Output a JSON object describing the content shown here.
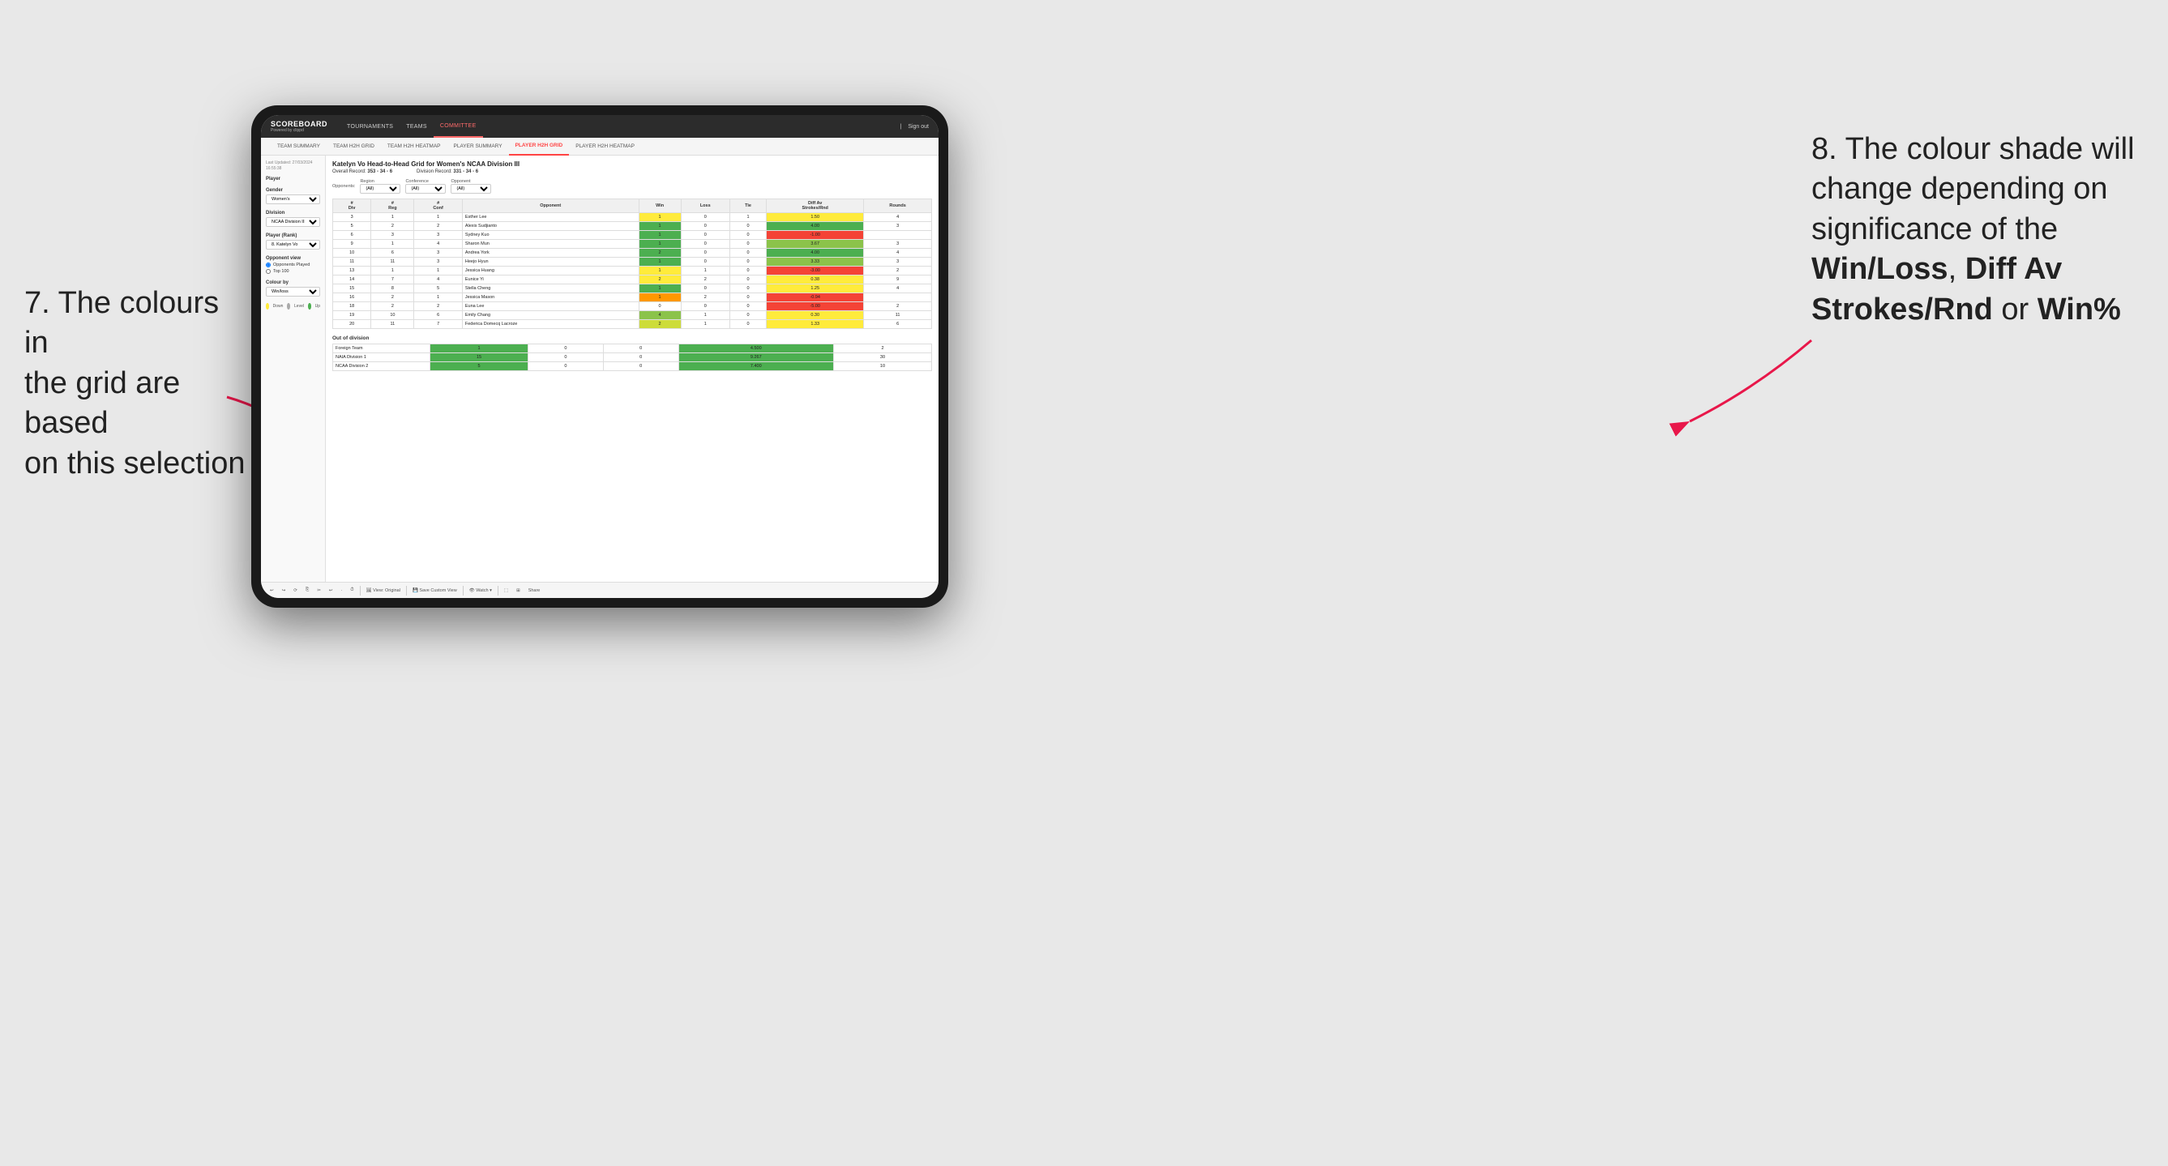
{
  "annotation_left": {
    "line1": "7. The colours in",
    "line2": "the grid are based",
    "line3": "on this selection"
  },
  "annotation_right": {
    "intro": "8. The colour shade will change depending on significance of the ",
    "bold1": "Win/Loss",
    "sep1": ", ",
    "bold2": "Diff Av Strokes/Rnd",
    "sep2": " or ",
    "bold3": "Win%"
  },
  "nav": {
    "logo": "SCOREBOARD",
    "logo_sub": "Powered by clippd",
    "items": [
      "TOURNAMENTS",
      "TEAMS",
      "COMMITTEE"
    ],
    "active": "COMMITTEE",
    "right": "Sign out"
  },
  "sub_nav": {
    "items": [
      "TEAM SUMMARY",
      "TEAM H2H GRID",
      "TEAM H2H HEATMAP",
      "PLAYER SUMMARY",
      "PLAYER H2H GRID",
      "PLAYER H2H HEATMAP"
    ],
    "active": "PLAYER H2H GRID"
  },
  "sidebar": {
    "last_updated": "Last Updated: 27/03/2024\n16:55:38",
    "player_label": "Player",
    "gender_label": "Gender",
    "gender_value": "Women's",
    "division_label": "Division",
    "division_value": "NCAA Division III",
    "player_rank_label": "Player (Rank)",
    "player_rank_value": "8. Katelyn Vo",
    "opponent_view_label": "Opponent view",
    "opponent_options": [
      "Opponents Played",
      "Top 100"
    ],
    "opponent_selected": "Opponents Played",
    "colour_by_label": "Colour by",
    "colour_by_value": "Win/loss",
    "legend": {
      "down_color": "#ffeb3b",
      "level_color": "#aaaaaa",
      "up_color": "#4caf50",
      "down_label": "Down",
      "level_label": "Level",
      "up_label": "Up"
    }
  },
  "grid": {
    "title": "Katelyn Vo Head-to-Head Grid for Women's NCAA Division III",
    "overall_record": "353 - 34 - 6",
    "division_record": "331 - 34 - 6",
    "filters": {
      "region_label": "Region",
      "region_value": "(All)",
      "conference_label": "Conference",
      "conference_value": "(All)",
      "opponent_label": "Opponent",
      "opponent_value": "(All)",
      "opponents_label": "Opponents:"
    },
    "table_headers": [
      "#\nDiv",
      "#\nReg",
      "#\nConf",
      "Opponent",
      "Win",
      "Loss",
      "Tie",
      "Diff Av\nStrokes/Rnd",
      "Rounds"
    ],
    "rows": [
      {
        "div": "3",
        "reg": "1",
        "conf": "1",
        "opponent": "Esther Lee",
        "win": 1,
        "loss": 0,
        "tie": 1,
        "diff": "1.50",
        "rounds": 4,
        "win_color": "yellow",
        "diff_color": "yellow"
      },
      {
        "div": "5",
        "reg": "2",
        "conf": "2",
        "opponent": "Alexis Sudjianto",
        "win": 1,
        "loss": 0,
        "tie": 0,
        "diff": "4.00",
        "rounds": 3,
        "win_color": "green-dark",
        "diff_color": "green-dark"
      },
      {
        "div": "6",
        "reg": "3",
        "conf": "3",
        "opponent": "Sydney Kuo",
        "win": 1,
        "loss": 0,
        "tie": 0,
        "diff": "-1.00",
        "rounds": "",
        "win_color": "green-dark",
        "diff_color": "red"
      },
      {
        "div": "9",
        "reg": "1",
        "conf": "4",
        "opponent": "Sharon Mun",
        "win": 1,
        "loss": 0,
        "tie": 0,
        "diff": "3.67",
        "rounds": 3,
        "win_color": "green-dark",
        "diff_color": "green-med"
      },
      {
        "div": "10",
        "reg": "6",
        "conf": "3",
        "opponent": "Andrea York",
        "win": 2,
        "loss": 0,
        "tie": 0,
        "diff": "4.00",
        "rounds": 4,
        "win_color": "green-dark",
        "diff_color": "green-dark"
      },
      {
        "div": "11",
        "reg": "11",
        "conf": "3",
        "opponent": "Heejo Hyun",
        "win": 1,
        "loss": 0,
        "tie": 0,
        "diff": "3.33",
        "rounds": 3,
        "win_color": "green-dark",
        "diff_color": "green-med"
      },
      {
        "div": "13",
        "reg": "1",
        "conf": "1",
        "opponent": "Jessica Huang",
        "win": 1,
        "loss": 1,
        "tie": 0,
        "diff": "-3.00",
        "rounds": 2,
        "win_color": "yellow",
        "diff_color": "red"
      },
      {
        "div": "14",
        "reg": "7",
        "conf": "4",
        "opponent": "Eunice Yi",
        "win": 2,
        "loss": 2,
        "tie": 0,
        "diff": "0.38",
        "rounds": 9,
        "win_color": "yellow",
        "diff_color": "yellow"
      },
      {
        "div": "15",
        "reg": "8",
        "conf": "5",
        "opponent": "Stella Cheng",
        "win": 1,
        "loss": 0,
        "tie": 0,
        "diff": "1.25",
        "rounds": 4,
        "win_color": "green-dark",
        "diff_color": "yellow"
      },
      {
        "div": "16",
        "reg": "2",
        "conf": "1",
        "opponent": "Jessica Mason",
        "win": 1,
        "loss": 2,
        "tie": 0,
        "diff": "-0.94",
        "rounds": "",
        "win_color": "orange",
        "diff_color": "red"
      },
      {
        "div": "18",
        "reg": "2",
        "conf": "2",
        "opponent": "Euna Lee",
        "win": 0,
        "loss": 0,
        "tie": 0,
        "diff": "-5.00",
        "rounds": 2,
        "win_color": "white",
        "diff_color": "red"
      },
      {
        "div": "19",
        "reg": "10",
        "conf": "6",
        "opponent": "Emily Chang",
        "win": 4,
        "loss": 1,
        "tie": 0,
        "diff": "0.30",
        "rounds": 11,
        "win_color": "green-med",
        "diff_color": "yellow"
      },
      {
        "div": "20",
        "reg": "11",
        "conf": "7",
        "opponent": "Federica Domecq Lacroze",
        "win": 2,
        "loss": 1,
        "tie": 0,
        "diff": "1.33",
        "rounds": 6,
        "win_color": "green-light",
        "diff_color": "yellow"
      }
    ],
    "out_of_division_label": "Out of division",
    "out_of_division_rows": [
      {
        "label": "Foreign Team",
        "win": 1,
        "loss": 0,
        "tie": 0,
        "diff": "4.500",
        "rounds": 2,
        "win_color": "green-dark",
        "diff_color": "green-dark"
      },
      {
        "label": "NAIA Division 1",
        "win": 15,
        "loss": 0,
        "tie": 0,
        "diff": "9.267",
        "rounds": 30,
        "win_color": "green-dark",
        "diff_color": "green-dark"
      },
      {
        "label": "NCAA Division 2",
        "win": 5,
        "loss": 0,
        "tie": 0,
        "diff": "7.400",
        "rounds": 10,
        "win_color": "green-dark",
        "diff_color": "green-dark"
      }
    ]
  },
  "toolbar": {
    "buttons": [
      "↩",
      "↪",
      "⟳",
      "⎘",
      "✂",
      "↩",
      "·",
      "⏱",
      "|",
      "🖼 View: Original",
      "|",
      "💾 Save Custom View",
      "|",
      "👁 Watch ▾",
      "|",
      "⬚",
      "⊞",
      "Share"
    ]
  }
}
